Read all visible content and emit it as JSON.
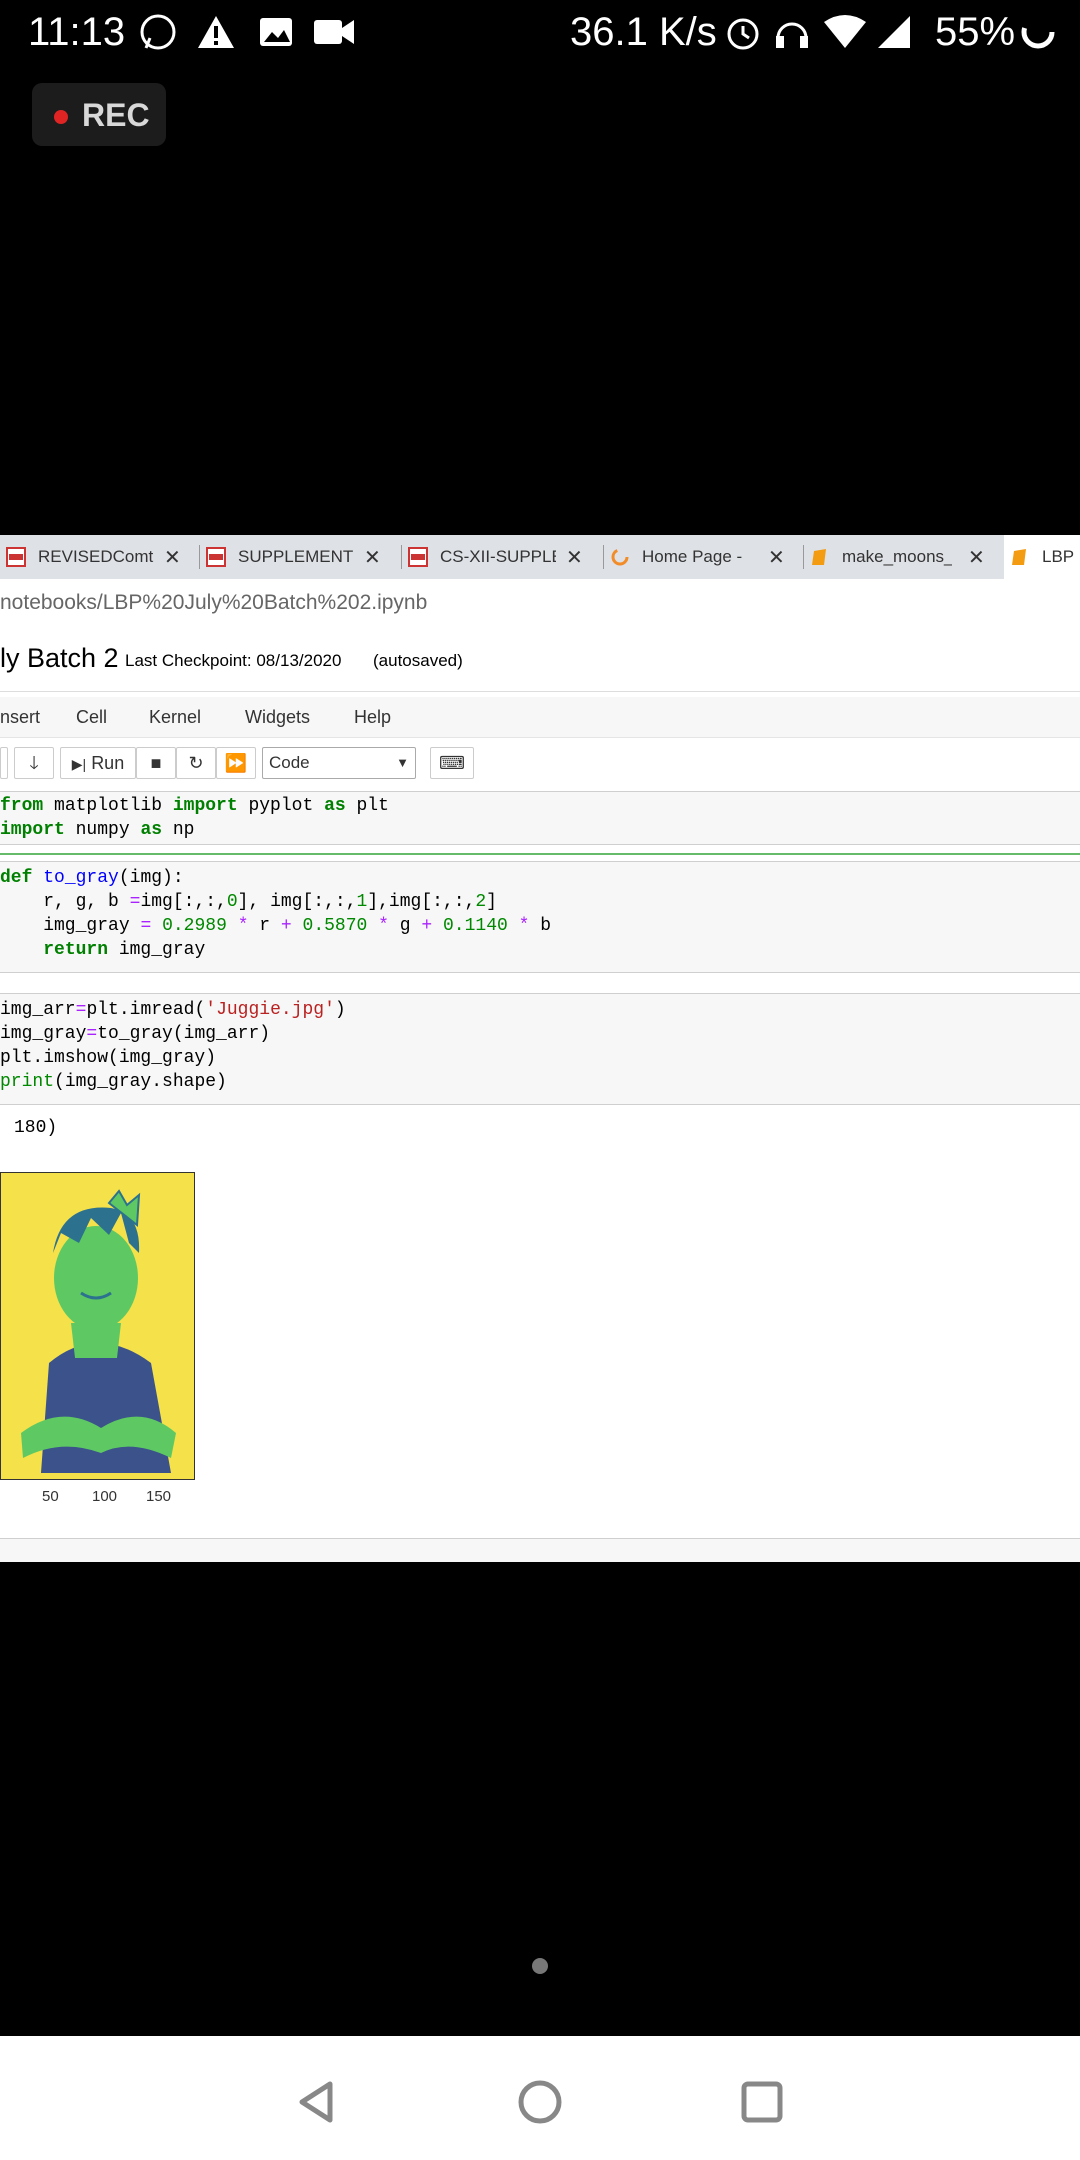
{
  "status_bar": {
    "time": "11:13",
    "net_speed": "36.1 K/s",
    "battery": "55%",
    "icons": [
      "whatsapp-icon",
      "warning-icon",
      "image-icon",
      "video-icon",
      "alarm-icon",
      "headset-icon",
      "wifi-icon",
      "signal-icon",
      "battery-ring-icon"
    ]
  },
  "recording": {
    "label": "REC"
  },
  "browser": {
    "tabs": [
      {
        "label": "REVISEDComt",
        "icon": "pdf-icon"
      },
      {
        "label": "SUPPLEMENT",
        "icon": "pdf-icon"
      },
      {
        "label": "CS-XII-SUPPLE",
        "icon": "pdf-icon"
      },
      {
        "label": "Home Page -",
        "icon": "spinner-icon"
      },
      {
        "label": "make_moons_",
        "icon": "notebook-icon"
      },
      {
        "label": "LBP",
        "icon": "notebook-icon"
      }
    ],
    "url": "notebooks/LBP%20July%20Batch%202.ipynb"
  },
  "notebook": {
    "title": "ly Batch 2",
    "checkpoint": "Last Checkpoint: 08/13/2020",
    "autosave": "(autosaved)",
    "menu": [
      "nsert",
      "Cell",
      "Kernel",
      "Widgets",
      "Help"
    ],
    "toolbar": {
      "run": "Run",
      "cell_type": "Code"
    },
    "output_text": "180)",
    "xticks": [
      "50",
      "100",
      "150"
    ]
  },
  "colors": {
    "accent": "#e02424",
    "viridis_yellow": "#f5e14a",
    "viridis_green": "#5ec962",
    "viridis_blue": "#3b528b"
  }
}
